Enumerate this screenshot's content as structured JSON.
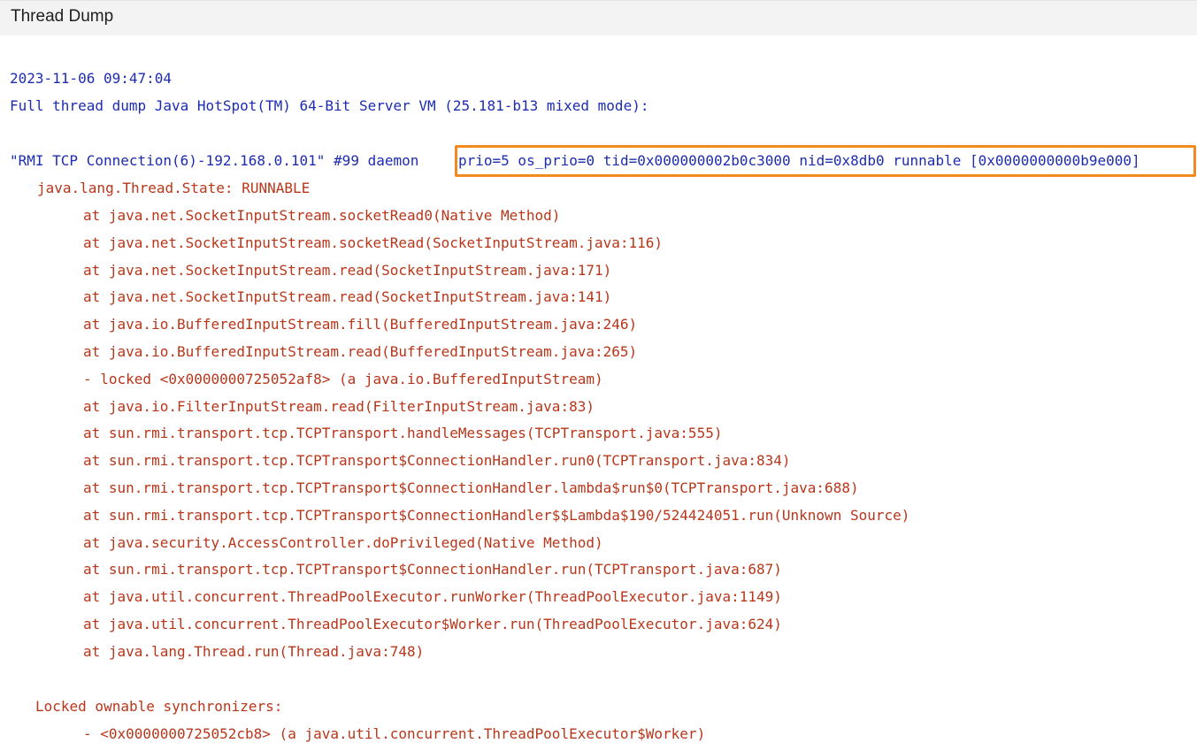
{
  "panel": {
    "title": "Thread Dump"
  },
  "dump": {
    "timestamp": "2023-11-06 09:47:04",
    "header": "Full thread dump Java HotSpot(TM) 64-Bit Server VM (25.181-b13 mixed mode):",
    "thread_name": "\"RMI TCP Connection(6)-192.168.0.101\" #99 daemon",
    "thread_details": "prio=5 os_prio=0 tid=0x000000002b0c3000 nid=0x8db0 runnable [0x0000000000b9e000]",
    "state": "java.lang.Thread.State: RUNNABLE",
    "stack": [
      "at java.net.SocketInputStream.socketRead0(Native Method)",
      "at java.net.SocketInputStream.socketRead(SocketInputStream.java:116)",
      "at java.net.SocketInputStream.read(SocketInputStream.java:171)",
      "at java.net.SocketInputStream.read(SocketInputStream.java:141)",
      "at java.io.BufferedInputStream.fill(BufferedInputStream.java:246)",
      "at java.io.BufferedInputStream.read(BufferedInputStream.java:265)",
      "- locked <0x0000000725052af8> (a java.io.BufferedInputStream)",
      "at java.io.FilterInputStream.read(FilterInputStream.java:83)",
      "at sun.rmi.transport.tcp.TCPTransport.handleMessages(TCPTransport.java:555)",
      "at sun.rmi.transport.tcp.TCPTransport$ConnectionHandler.run0(TCPTransport.java:834)",
      "at sun.rmi.transport.tcp.TCPTransport$ConnectionHandler.lambda$run$0(TCPTransport.java:688)",
      "at sun.rmi.transport.tcp.TCPTransport$ConnectionHandler$$Lambda$190/524424051.run(Unknown Source)",
      "at java.security.AccessController.doPrivileged(Native Method)",
      "at sun.rmi.transport.tcp.TCPTransport$ConnectionHandler.run(TCPTransport.java:687)",
      "at java.util.concurrent.ThreadPoolExecutor.runWorker(ThreadPoolExecutor.java:1149)",
      "at java.util.concurrent.ThreadPoolExecutor$Worker.run(ThreadPoolExecutor.java:624)",
      "at java.lang.Thread.run(Thread.java:748)"
    ],
    "locked_header": "Locked ownable synchronizers:",
    "locked_items": [
      "- <0x0000000725052cb8> (a java.util.concurrent.ThreadPoolExecutor$Worker)"
    ]
  },
  "colors": {
    "thread_text": "#1d2cb0",
    "stack_text": "#b8361a",
    "highlight_border": "#f28a1f"
  }
}
